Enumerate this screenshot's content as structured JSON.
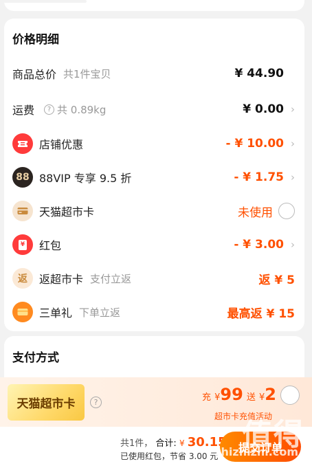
{
  "price_card": {
    "title": "价格明细",
    "items": [
      {
        "label": "商品总价",
        "sub": "共1件宝贝",
        "value": "¥ 44.90"
      },
      {
        "label": "运费",
        "sub": "共 0.89kg",
        "value": "¥ 0.00"
      },
      {
        "label": "店铺优惠",
        "value": "- ¥ 10.00",
        "icon": "ticket-icon"
      },
      {
        "label": "88VIP 专享 9.5 折",
        "value": "- ¥ 1.75",
        "icon": "vip-88-icon",
        "icon_text": "88"
      },
      {
        "label": "天猫超市卡",
        "value": "未使用",
        "icon": "card-icon"
      },
      {
        "label": "红包",
        "value": "- ¥ 3.00",
        "icon": "red-packet-icon",
        "icon_text": "¥"
      },
      {
        "label": "返超市卡",
        "sub": "支付立返",
        "value": "返 ¥ 5",
        "icon": "return-icon",
        "icon_text": "返"
      },
      {
        "label": "三单礼",
        "sub": "下单立返",
        "value": "最高返 ¥ 15",
        "icon": "gift-card-icon"
      }
    ],
    "help_glyph": "?"
  },
  "payment": {
    "title": "支付方式",
    "card_name": "天猫超市卡",
    "help_glyph": "?",
    "promo": {
      "prefix": "充",
      "yen": "¥",
      "amount": "99",
      "give": "送",
      "bonus": "2"
    },
    "promo_sub": "超市卡充值活动"
  },
  "footer": {
    "count": "共1件，",
    "total_label": "合计:",
    "yen": "¥",
    "total": "30.15",
    "discount_note": "已使用红包，节省 3.00 元",
    "submit_label": "提交订单"
  },
  "watermark": {
    "text": "值得",
    "url": "zhizhizhi.com"
  },
  "colors": {
    "accent": "#ff5000",
    "bg": "#f2f2f2"
  }
}
